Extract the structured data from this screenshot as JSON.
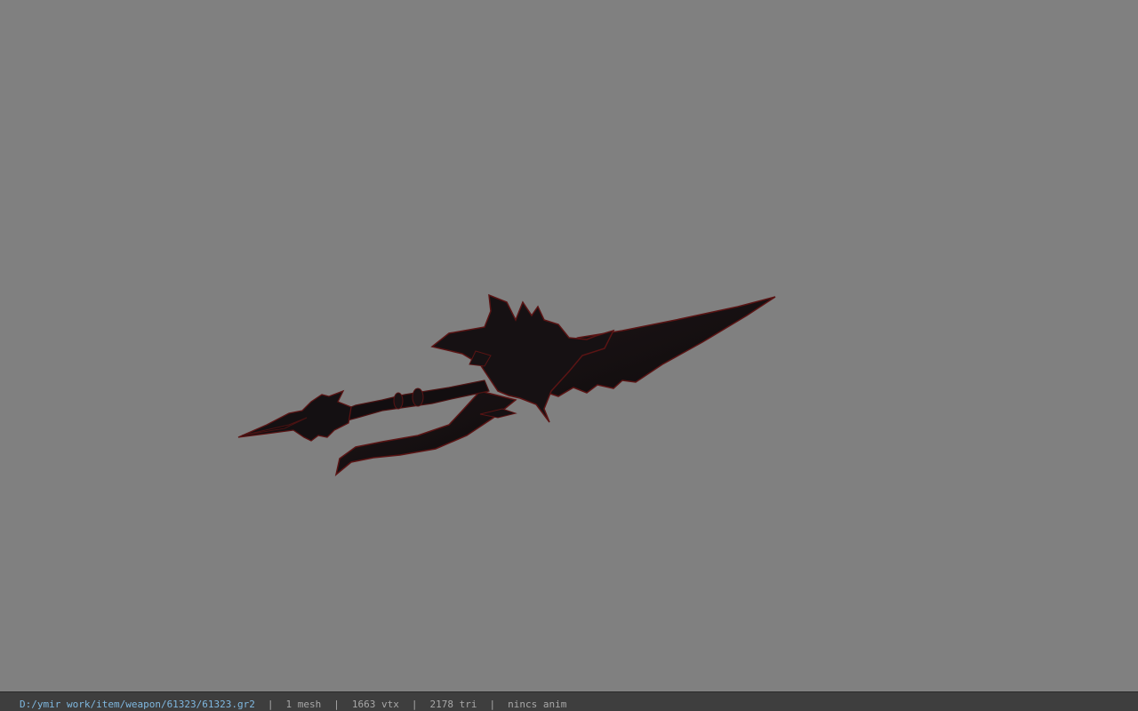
{
  "status": {
    "file_path": "D:/ymir work/item/weapon/61323/61323.gr2",
    "mesh_count": "1 mesh",
    "vertex_count": "1663 vtx",
    "triangle_count": "2178 tri",
    "animation": "nincs anim",
    "separator": "|"
  },
  "viewport": {
    "background_color": "#808080",
    "model_colors": {
      "body": "#141012",
      "edge": "#5a1414"
    }
  }
}
